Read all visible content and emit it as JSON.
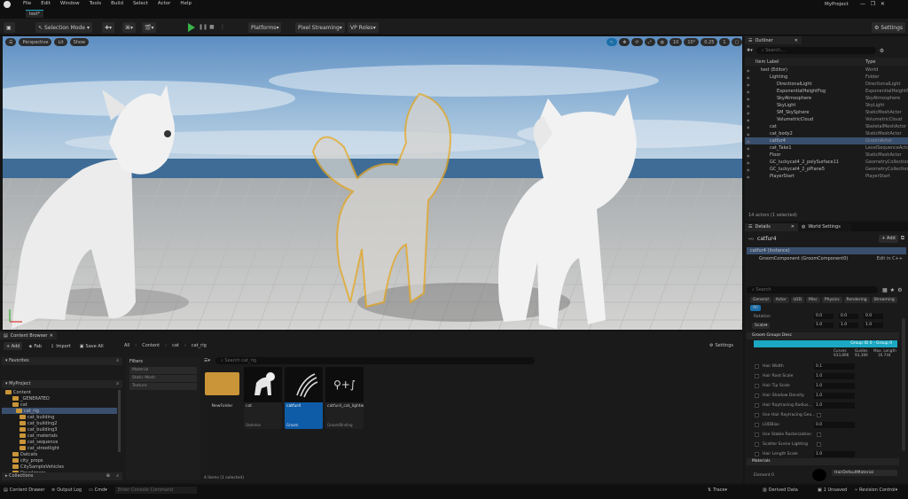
{
  "menu": {
    "items": [
      "File",
      "Edit",
      "Window",
      "Tools",
      "Build",
      "Select",
      "Actor",
      "Help"
    ],
    "project": "MyProject"
  },
  "tab": {
    "label": "test*"
  },
  "toolbar": {
    "mode": "Selection Mode",
    "platforms": "Platforms",
    "pixel_streaming": "Pixel Streaming",
    "vp_roles": "VP Roles",
    "settings": "Settings"
  },
  "viewport": {
    "perspective": "Perspective",
    "lit": "Lit",
    "show": "Show",
    "snap_values": [
      "10",
      "10°",
      "0.25"
    ],
    "cam_speed": "1"
  },
  "outliner": {
    "title": "Outliner",
    "search_placeholder": "Search...",
    "col_label": "Item Label",
    "col_type": "Type",
    "rows": [
      {
        "name": "test (Editor)",
        "type": "World"
      },
      {
        "name": "Lighting",
        "type": "Folder"
      },
      {
        "name": "DirectionalLight",
        "type": "DirectionalLight"
      },
      {
        "name": "ExponentialHeightFog",
        "type": "ExponentialHeightFo"
      },
      {
        "name": "SkyAtmosphere",
        "type": "SkyAtmosphere"
      },
      {
        "name": "SkyLight",
        "type": "SkyLight"
      },
      {
        "name": "SM_SkySphere",
        "type": "StaticMeshActor"
      },
      {
        "name": "VolumetricCloud",
        "type": "VolumetricCloud"
      },
      {
        "name": "cat",
        "type": "SkeletalMeshActor"
      },
      {
        "name": "cat_body2",
        "type": "StaticMeshActor"
      },
      {
        "name": "catfur4",
        "type": "GroomActor"
      },
      {
        "name": "cat_Take1",
        "type": "LevelSequenceActo"
      },
      {
        "name": "Floor",
        "type": "StaticMeshActor"
      },
      {
        "name": "GC_luckycat4_2_polySurface11",
        "type": "GeometryCollection_"
      },
      {
        "name": "GC_luckycat4_2_pPlane5",
        "type": "GeometryCollection_"
      },
      {
        "name": "PlayerStart",
        "type": "PlayerStart"
      }
    ],
    "footer": "14 actors (1 selected)"
  },
  "details": {
    "tab1": "Details",
    "tab2": "World Settings",
    "actor": "catfur4",
    "add": "+ Add",
    "instance": "catfur4 (Instance)",
    "component": "GroomComponent (GroomComponent0)",
    "edit_link": "Edit in C++",
    "search_placeholder": "Search",
    "categories": [
      "General",
      "Actor",
      "LOD",
      "Misc",
      "Physics",
      "Rendering",
      "Streaming",
      "All"
    ],
    "transform": {
      "rotation_label": "Rotation",
      "scale_label": "Scale",
      "values": [
        "0.0",
        "0.0",
        "0.0",
        "1.0",
        "1.0",
        "1.0"
      ]
    },
    "groom_section": "Groom Groups Desc",
    "group_header": "Group ID 0 - Group 0",
    "stats": {
      "curves_label": "Curves",
      "guides_label": "Guides",
      "max_length_label": "Max. Length",
      "curves": "933,896",
      "guides": "93,389",
      "max_length": "16.744"
    },
    "props": [
      {
        "label": "Hair Width",
        "value": "0.1"
      },
      {
        "label": "Hair Root Scale",
        "value": "1.0"
      },
      {
        "label": "Hair Tip Scale",
        "value": "1.0"
      },
      {
        "label": "Hair Shadow Density",
        "value": "1.0"
      },
      {
        "label": "Hair Raytracing Radius...",
        "value": "1.0"
      },
      {
        "label": "Use Hair Raytracing Geo...",
        "value": ""
      },
      {
        "label": "LODBias",
        "value": "0.0"
      },
      {
        "label": "Use Stable Rasterization",
        "value": ""
      },
      {
        "label": "Scatter Scene Lighting",
        "value": ""
      },
      {
        "label": "Hair Length Scale",
        "value": "1.0"
      }
    ],
    "materials_section": "Materials",
    "element0": "Element 0",
    "material": "HairDefaultMaterial"
  },
  "content_browser": {
    "title": "Content Browser",
    "add": "+ Add",
    "fab": "Fab",
    "import": "Import",
    "save_all": "Save All",
    "breadcrumb": [
      "All",
      "Content",
      "cat",
      "cat_rig"
    ],
    "settings": "Settings",
    "favorites": "Favorites",
    "project": "MyProject",
    "filters": "Filters",
    "search_placeholder": "Search cat_rig",
    "filter_items": [
      "Material",
      "Static Mesh",
      "Texture"
    ],
    "folders": [
      "Content",
      "_GENERATED",
      "cat",
      "cat_rig",
      "cat_building",
      "cat_building2",
      "cat_building3",
      "cat_materials",
      "cat_sequence",
      "cat_streetlight",
      "Datcats",
      "city_props",
      "CitySampleVehicles",
      "Developers"
    ],
    "assets": [
      {
        "name": "NewFolder",
        "type": ""
      },
      {
        "name": "cat",
        "type": "Skeleton"
      },
      {
        "name": "catfur4",
        "type": "Groom"
      },
      {
        "name": "catfur4_cat_lightweight_finalbinding",
        "type": "GroomBinding"
      }
    ],
    "status": "4 items (1 selected)",
    "collections": "Collections"
  },
  "bottombar": {
    "content_drawer": "Content Drawer",
    "output_log": "Output Log",
    "cmd": "Cmd",
    "console_placeholder": "Enter Console Command",
    "trace": "Trace",
    "derived_data": "Derived Data",
    "unsaved": "1 Unsaved",
    "revision": "Revision Control"
  },
  "colors": {
    "accent": "#1ba8c2",
    "selection": "#3a4f6e",
    "play_green": "#39b34a",
    "folder": "#c99538",
    "groom_outline": "#e8a820"
  }
}
